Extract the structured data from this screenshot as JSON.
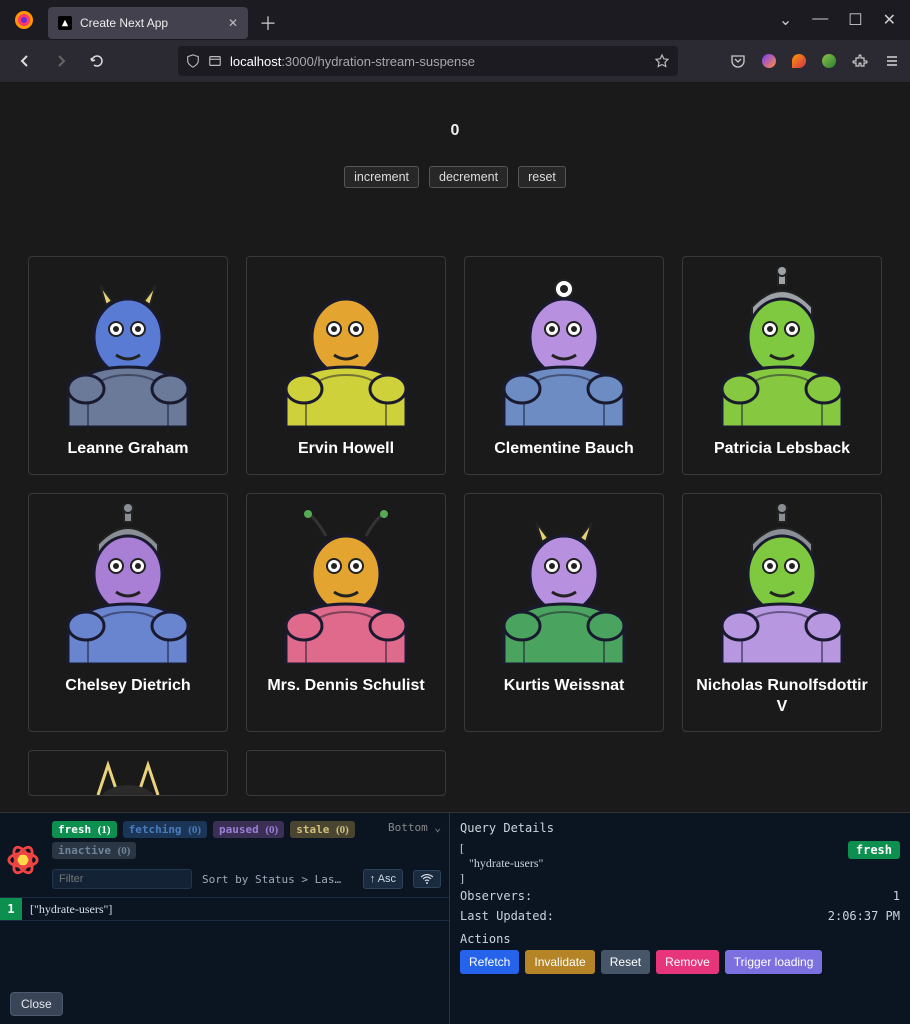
{
  "browser": {
    "tab_title": "Create Next App",
    "url_domain": "localhost",
    "url_port": ":3000",
    "url_path": "/hydration-stream-suspense"
  },
  "counter": {
    "value": "0",
    "increment": "increment",
    "decrement": "decrement",
    "reset": "reset"
  },
  "users": [
    {
      "name": "Leanne Graham",
      "skin": "#5a7bd4",
      "armor": "#6b7a99",
      "extra": "horn",
      "extra_color": "#e9d27a"
    },
    {
      "name": "Ervin Howell",
      "skin": "#e3a52f",
      "armor": "#cfd13a",
      "extra": "none",
      "extra_color": "#000"
    },
    {
      "name": "Clementine Bauch",
      "skin": "#b890e0",
      "armor": "#6d8cc4",
      "extra": "eye",
      "extra_color": "#3a5"
    },
    {
      "name": "Patricia Lebsback",
      "skin": "#7ec93f",
      "armor": "#86c840",
      "extra": "helmet",
      "extra_color": "#9da2a6"
    },
    {
      "name": "Chelsey Dietrich",
      "skin": "#a97fd6",
      "armor": "#6a85cf",
      "extra": "helmet",
      "extra_color": "#8a8f96"
    },
    {
      "name": "Mrs. Dennis Schulist",
      "skin": "#e3a52f",
      "armor": "#e06a8b",
      "extra": "antenna",
      "extra_color": "#5a5"
    },
    {
      "name": "Kurtis Weissnat",
      "skin": "#b890e0",
      "armor": "#4aa35f",
      "extra": "horn",
      "extra_color": "#e9d27a"
    },
    {
      "name": "Nicholas Runolfsdottir V",
      "skin": "#7ec93f",
      "armor": "#b697e0",
      "extra": "helmet",
      "extra_color": "#8a8f96"
    }
  ],
  "devtools": {
    "badges": {
      "fresh_label": "fresh",
      "fresh_count": "(1)",
      "fetching_label": "fetching",
      "fetching_count": "(0)",
      "paused_label": "paused",
      "paused_count": "(0)",
      "stale_label": "stale",
      "stale_count": "(0)",
      "inactive_label": "inactive",
      "inactive_count": "(0)"
    },
    "position": "Bottom",
    "filter_placeholder": "Filter",
    "sort_label": "Sort by Status > Last Up",
    "asc_label": "↑ Asc",
    "query_count": "1",
    "query_key": "[\"hydrate-users\"]",
    "close": "Close",
    "details_title": "Query Details",
    "details_key": "[\n   \"hydrate-users\"\n]",
    "status_pill": "fresh",
    "observers_label": "Observers:",
    "observers_value": "1",
    "updated_label": "Last Updated:",
    "updated_value": "2:06:37 PM",
    "actions_label": "Actions",
    "actions": {
      "refetch": "Refetch",
      "invalidate": "Invalidate",
      "reset": "Reset",
      "remove": "Remove",
      "trigger": "Trigger loading"
    }
  }
}
